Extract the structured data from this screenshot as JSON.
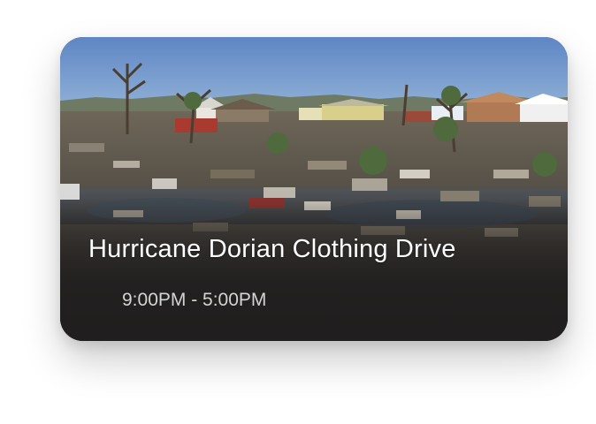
{
  "event_card": {
    "title": "Hurricane Dorian Clothing Drive",
    "time_range": "9:00PM - 5:00PM",
    "image_description_icon": "hurricane-aftermath-photo",
    "colors": {
      "sky": "#5e87c4",
      "overlay": "#201e1e",
      "title_text": "#ffffff",
      "time_text": "#d4d4d4"
    }
  }
}
